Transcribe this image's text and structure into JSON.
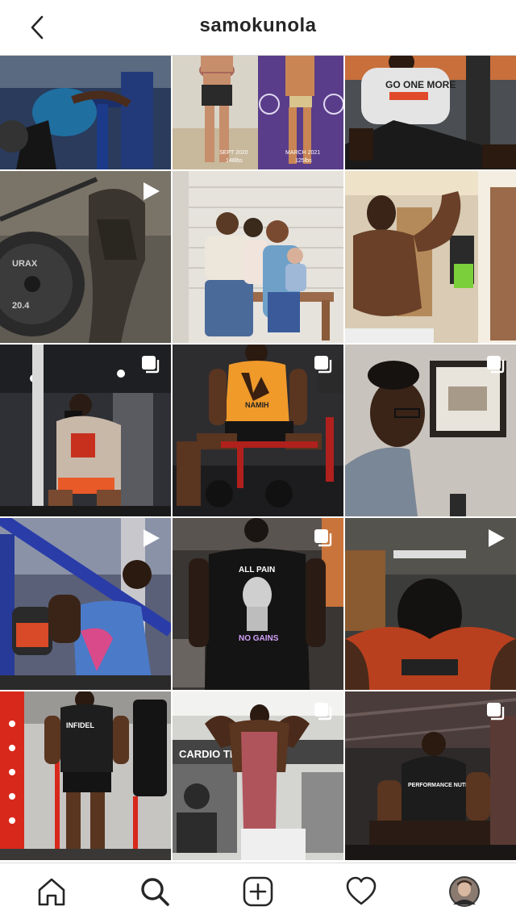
{
  "header": {
    "username": "samokunola",
    "back_icon": "chevron-left-icon"
  },
  "grid": {
    "tiles": [
      {
        "type": "photo",
        "subject": "gym machine workout"
      },
      {
        "type": "photo",
        "subject": "before and after transformation",
        "captions": {
          "left_date": "SEPT 2020",
          "left_weight": "148lbs",
          "right_date": "MARCH 2021",
          "right_weight": "125lbs"
        }
      },
      {
        "type": "photo",
        "subject": "seated stretch",
        "shirt_text": "GO ONE MORE"
      },
      {
        "type": "video",
        "subject": "weight plate close-up",
        "plate_text": "URAX",
        "plate_weight": "20.4"
      },
      {
        "type": "photo",
        "subject": "family photo"
      },
      {
        "type": "photo",
        "subject": "flexing bicep"
      },
      {
        "type": "carousel",
        "subject": "athlete seated in gym"
      },
      {
        "type": "carousel",
        "subject": "seated with kettlebells",
        "shirt_text": "NAMIH"
      },
      {
        "type": "carousel",
        "subject": "portrait with glasses"
      },
      {
        "type": "video",
        "subject": "incline press"
      },
      {
        "type": "carousel",
        "subject": "standing in gym",
        "shirt_top": "ALL PAIN",
        "shirt_bottom": "NO GAINS"
      },
      {
        "type": "video",
        "subject": "head down close-up"
      },
      {
        "type": "photo",
        "subject": "standing by rack",
        "shirt_text": "INFIDEL"
      },
      {
        "type": "carousel",
        "subject": "back double biceps",
        "wall_text": "CARDIO THEA"
      },
      {
        "type": "carousel",
        "subject": "seated in gym",
        "shirt_text": "PERFORMANCE NUTRITION"
      }
    ]
  },
  "tabbar": {
    "items": [
      {
        "name": "home",
        "icon": "home-icon"
      },
      {
        "name": "search",
        "icon": "search-icon"
      },
      {
        "name": "new-post",
        "icon": "plus-square-icon"
      },
      {
        "name": "activity",
        "icon": "heart-icon"
      },
      {
        "name": "profile",
        "icon": "avatar-icon"
      }
    ]
  }
}
